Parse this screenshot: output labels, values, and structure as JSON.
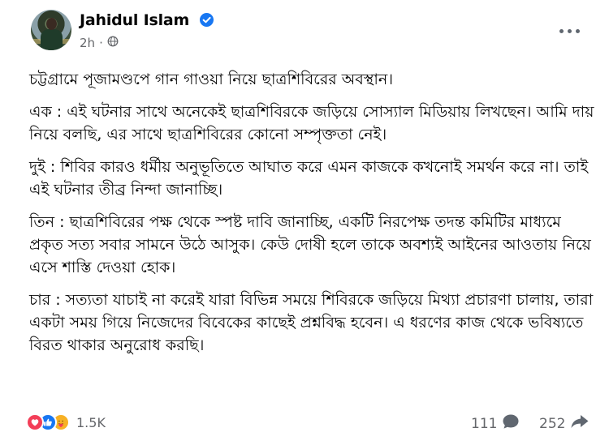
{
  "post": {
    "author": "Jahidul Islam",
    "time": "2h",
    "audience_icon": "globe-icon",
    "paragraphs": [
      "চট্টগ্রামে পূজামণ্ডপে গান গাওয়া নিয়ে ছাত্রশিবিরের অবস্থান।",
      "এক : এই ঘটনার সাথে অনেকেই ছাত্রশিবিরকে জড়িয়ে সোস্যাল মিডিয়ায় লিখছেন। আমি দায় নিয়ে বলছি, এর সাথে ছাত্রশিবিরের কোনো সম্পৃক্ততা নেই।",
      "দুই : শিবির কারও ধর্মীয় অনুভূতিতে আঘাত করে এমন কাজকে কখনোই সমর্থন করে না। তাই এই ঘটনার তীব্র নিন্দা জানাচ্ছি।",
      "তিন : ছাত্রশিবিরের পক্ষ থেকে স্পষ্ট দাবি জানাচ্ছি, একটি নিরপেক্ষ তদন্ত কমিটির মাধ্যমে প্রকৃত সত্য সবার সামনে উঠে আসুক। কেউ দোষী হলে তাকে অবশ্যই আইনের আওতায় নিয়ে এসে শাস্তি দেওয়া হোক।",
      "চার : সত্যতা যাচাই না করেই যারা বিভিন্ন সময়ে শিবিরকে জড়িয়ে মিথ্যা প্রচারণা চালায়, তারা একটা সময় গিয়ে নিজেদের বিবেকের কাছেই প্রশ্নবিদ্ধ হবেন। এ ধরণের কাজ থেকে ভবিষ্যতে বিরত থাকার অনুরোধ করছি।"
    ]
  },
  "stats": {
    "reactions_count": "1.5K",
    "comments_count": "111",
    "shares_count": "252",
    "reaction_icons": [
      "love-icon",
      "like-icon",
      "care-icon"
    ]
  },
  "colors": {
    "verified": "#1877f2",
    "secondary_text": "#65676b"
  }
}
